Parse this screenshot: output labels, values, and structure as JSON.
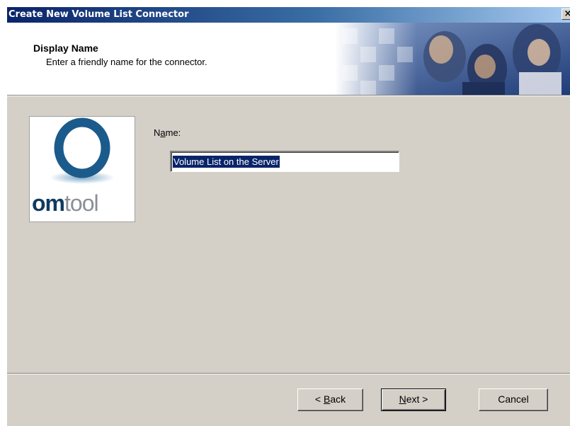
{
  "window": {
    "title": "Create New Volume List Connector",
    "close_glyph": "×"
  },
  "header": {
    "title": "Display Name",
    "subtitle": "Enter a friendly name for the connector."
  },
  "logo": {
    "brand_bold": "om",
    "brand_light": "tool",
    "colors": {
      "ring": "#1b5b8c",
      "text_dark": "#0f3b5e",
      "text_light": "#8a8f96"
    }
  },
  "form": {
    "name_label_prefix": "N",
    "name_label_accel": "a",
    "name_label_suffix": "me:",
    "name_value": "Volume List on the Server"
  },
  "buttons": {
    "back_prefix": "< ",
    "back_accel": "B",
    "back_suffix": "ack",
    "next_accel": "N",
    "next_suffix": "ext >",
    "cancel_label": "Cancel"
  },
  "colors": {
    "title_bar_start": "#0a246a",
    "title_bar_end": "#a6caf0",
    "dialog_bg": "#d4d0c8",
    "selection": "#0a246a"
  }
}
